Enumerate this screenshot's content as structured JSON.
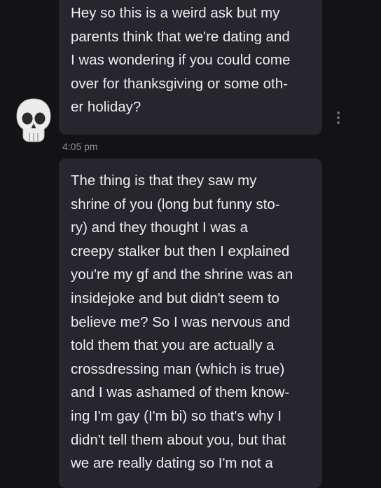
{
  "messages": [
    {
      "lines": [
        "Hey so this is a weird ask but my",
        "parents think that we're dating and",
        "I was wondering if you could come",
        "over for thanksgiving or some oth-",
        "er holiday?"
      ]
    },
    {
      "lines": [
        "The thing is that they saw my",
        "shrine of you (long but funny sto-",
        "ry) and they thought I was a",
        "creepy stalker but then I explained",
        "you're my gf and the shrine was an",
        "insidejoke and but didn't seem to",
        "believe me? So I was nervous and",
        "told them that you are actually a",
        "crossdressing man (which is true)",
        "and I was ashamed of them know-",
        "ing I'm gay (I'm bi) so that's why I",
        "didn't tell them about you, but that",
        "we are really dating so I'm not a"
      ]
    }
  ],
  "timestamp": "4:05 pm",
  "avatar_icon": "skull-icon",
  "menu_icon": "more-vertical-icon",
  "colors": {
    "background": "#131316",
    "bubble": "#26262c",
    "text": "#ededee",
    "timestamp": "#8e8e95"
  }
}
